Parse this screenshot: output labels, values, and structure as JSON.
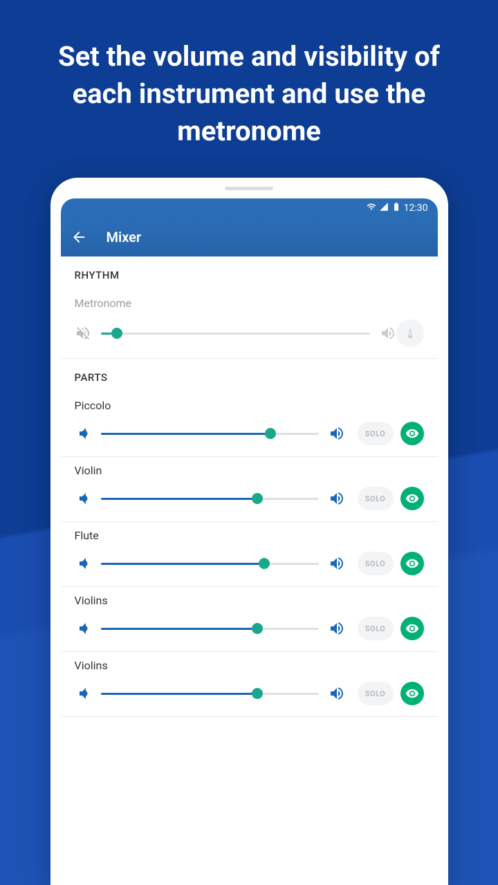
{
  "hero": "Set the volume and visibility of each instrument and use the metronome",
  "statusbar": {
    "time": "12:30"
  },
  "appbar": {
    "title": "Mixer"
  },
  "sections": {
    "rhythm_header": "RHYTHM",
    "parts_header": "PARTS"
  },
  "metronome": {
    "label": "Metronome",
    "volume_percent": 6
  },
  "parts": [
    {
      "label": "Piccolo",
      "volume_percent": 78,
      "solo": "SOLO"
    },
    {
      "label": "Violin",
      "volume_percent": 72,
      "solo": "SOLO"
    },
    {
      "label": "Flute",
      "volume_percent": 75,
      "solo": "SOLO"
    },
    {
      "label": "Violins",
      "volume_percent": 72,
      "solo": "SOLO"
    },
    {
      "label": "Violins",
      "volume_percent": 72,
      "solo": "SOLO"
    }
  ],
  "colors": {
    "accent_blue": "#1a66b7",
    "accent_green": "#19a88c",
    "eye_green": "#00b075",
    "muted": "#b6bcc2"
  }
}
